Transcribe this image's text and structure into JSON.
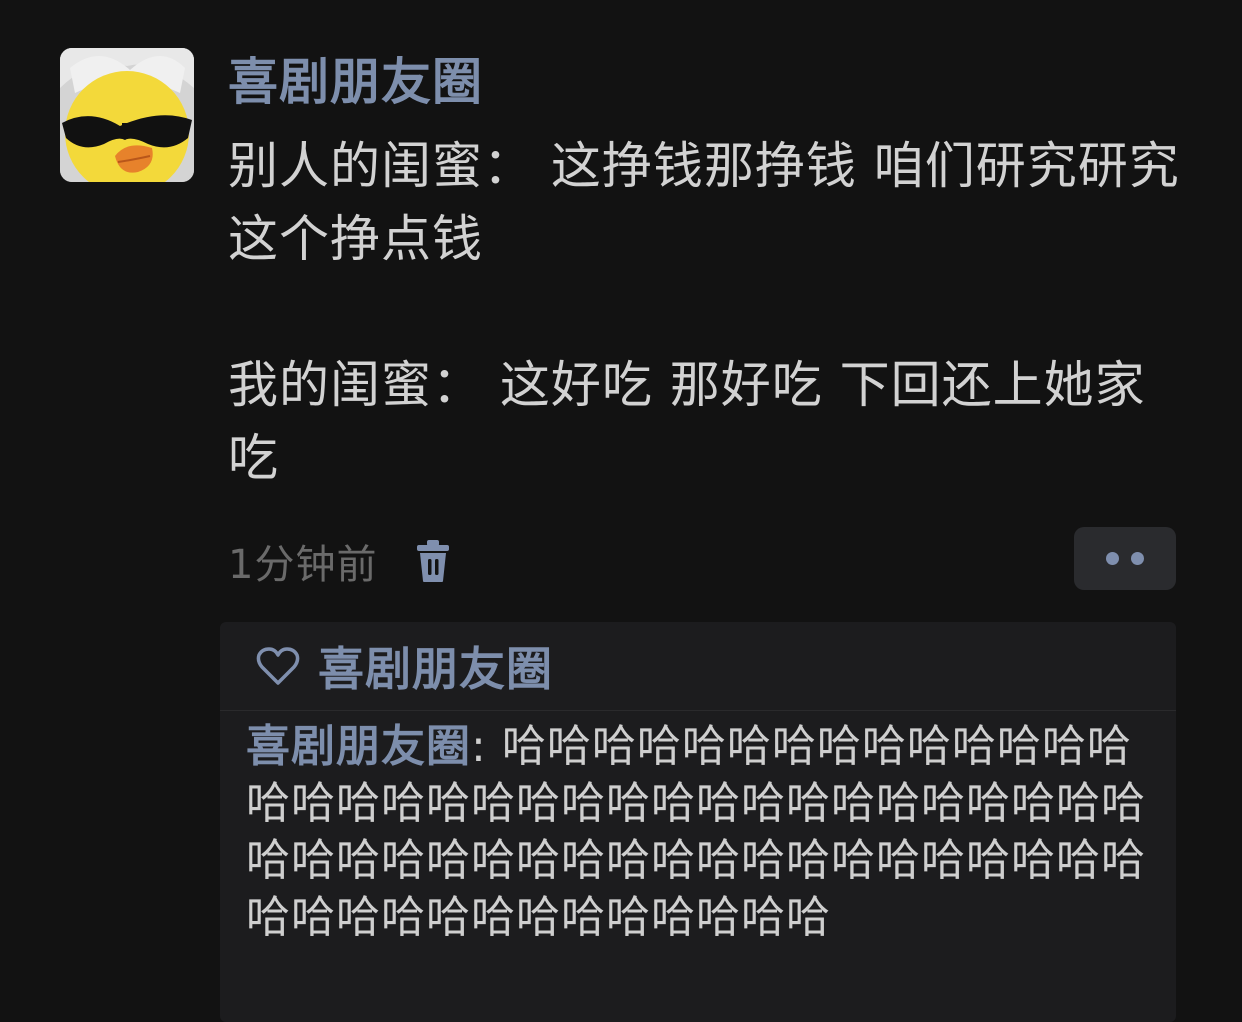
{
  "post": {
    "author": "喜剧朋友圈",
    "avatar_icon": "duck-with-sunglasses-icon",
    "paragraphs": [
      "别人的闺蜜：  这挣钱那挣钱 咱们研究研究这个挣点钱",
      "",
      "我的闺蜜：  这好吃 那好吃 下回还上她家吃"
    ],
    "timestamp": "1分钟前",
    "delete_icon": "trash-icon",
    "more_icon": "more-dots-icon"
  },
  "likes": {
    "icon": "heart-outline-icon",
    "names": "喜剧朋友圈"
  },
  "comment": {
    "author": "喜剧朋友圈",
    "separator": ":",
    "text": "哈哈哈哈哈哈哈哈哈哈哈哈哈哈哈哈哈哈哈哈哈哈哈哈哈哈哈哈哈哈哈哈哈哈哈哈哈哈哈哈哈哈哈哈哈哈哈哈哈哈哈哈哈哈哈哈哈哈哈哈哈哈哈哈哈哈哈"
  },
  "colors": {
    "background": "#121212",
    "name_accent": "#7d8eac",
    "timestamp": "#6a6a6a"
  }
}
